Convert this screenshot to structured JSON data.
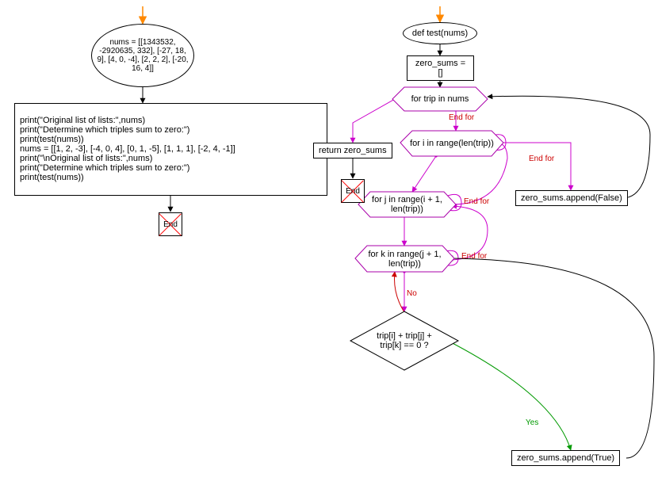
{
  "left_flow": {
    "start_ellipse": "nums = [[1343532, -2920635, 332], [-27, 18, 9], [4, 0, -4], [2, 2, 2], [-20, 16, 4]]",
    "print_block": "print(\"Original list of lists:\",nums)\nprint(\"Determine which triples sum to zero:\")\nprint(test(nums))\nnums = [[1, 2, -3], [-4, 0, 4], [0, 1, -5], [1, 1, 1], [-2, 4, -1]]\nprint(\"\\nOriginal list of lists:\",nums)\nprint(\"Determine which triples sum to zero:\")\nprint(test(nums))",
    "end": "End"
  },
  "right_flow": {
    "def_ellipse": "def test(nums)",
    "zero_sums_init": "zero_sums = []",
    "for_trip": "for trip in nums",
    "return_stmt": "return zero_sums",
    "for_i": "for i in range(len(trip))",
    "for_j": "for j in range(i + 1, len(trip))",
    "for_k": "for k in range(j + 1, len(trip))",
    "condition": "trip[i] + trip[j] + trip[k] == 0 ?",
    "append_true": "zero_sums.append(True)",
    "append_false": "zero_sums.append(False)",
    "end": "End"
  },
  "labels": {
    "end_for": "End for",
    "no": "No",
    "yes": "Yes"
  }
}
